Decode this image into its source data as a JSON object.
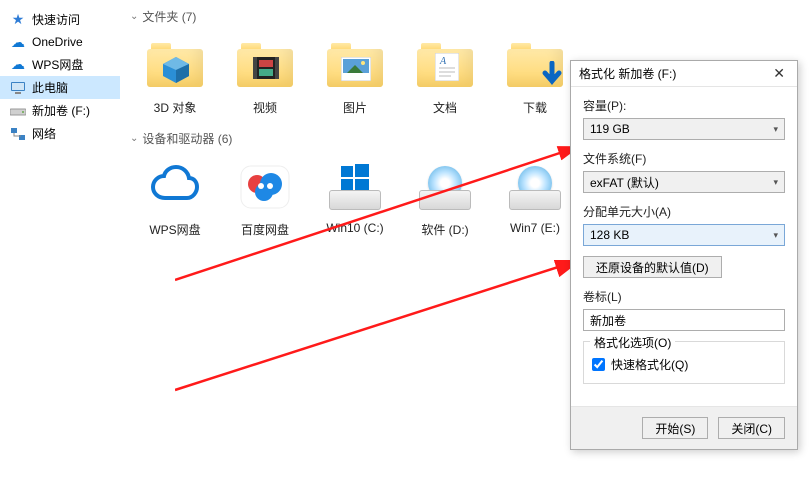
{
  "sidebar": {
    "items": [
      {
        "label": "快速访问",
        "icon": "star"
      },
      {
        "label": "OneDrive",
        "icon": "cloud"
      },
      {
        "label": "WPS网盘",
        "icon": "cloud"
      },
      {
        "label": "此电脑",
        "icon": "pc"
      },
      {
        "label": "新加卷 (F:)",
        "icon": "drive"
      },
      {
        "label": "网络",
        "icon": "network"
      }
    ]
  },
  "sections": {
    "folders": {
      "title": "文件夹 (7)",
      "items": [
        {
          "label": "3D 对象",
          "icon": "folder-3d"
        },
        {
          "label": "视频",
          "icon": "folder-video"
        },
        {
          "label": "图片",
          "icon": "folder-picture"
        },
        {
          "label": "文档",
          "icon": "folder-doc"
        },
        {
          "label": "下载",
          "icon": "folder-download"
        }
      ]
    },
    "drives": {
      "title": "设备和驱动器 (6)",
      "items": [
        {
          "label": "WPS网盘",
          "icon": "wps"
        },
        {
          "label": "百度网盘",
          "icon": "baidu"
        },
        {
          "label": "Win10 (C:)",
          "icon": "drive"
        },
        {
          "label": "软件 (D:)",
          "icon": "drive"
        },
        {
          "label": "Win7 (E:)",
          "icon": "drive"
        }
      ]
    }
  },
  "dialog": {
    "title": "格式化 新加卷 (F:)",
    "capacity_label": "容量(P):",
    "capacity_value": "119 GB",
    "fs_label": "文件系统(F)",
    "fs_value": "exFAT (默认)",
    "alloc_label": "分配单元大小(A)",
    "alloc_value": "128 KB",
    "restore_btn": "还原设备的默认值(D)",
    "vol_label": "卷标(L)",
    "vol_value": "新加卷",
    "options_label": "格式化选项(O)",
    "quick_label": "快速格式化(Q)",
    "start_btn": "开始(S)",
    "close_btn": "关闭(C)"
  }
}
